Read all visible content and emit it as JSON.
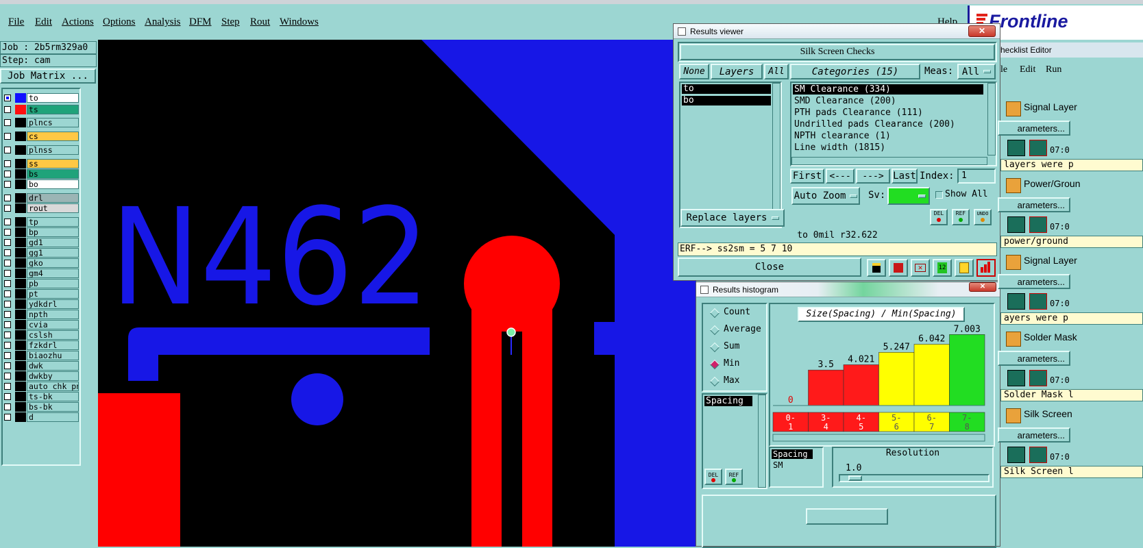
{
  "menubar": {
    "items": [
      "File",
      "Edit",
      "Actions",
      "Options",
      "Analysis",
      "DFM",
      "Step",
      "Rout",
      "Windows"
    ],
    "help": "Help",
    "brand": "Frontline"
  },
  "left": {
    "job": "Job : 2b5rm329a0",
    "step": "Step: cam",
    "job_matrix": "Job Matrix ...",
    "layers": [
      {
        "name": "to",
        "color": "#ffffff",
        "swatch": "#1010ff",
        "checked": true
      },
      {
        "name": "ts",
        "color": "#1fa37a",
        "swatch": "#ff1010",
        "checked": false
      },
      {
        "name": "plncs",
        "color": "#9cd6d2",
        "swatch": "#000000",
        "checked": false
      },
      {
        "name": "cs",
        "color": "#ffc845",
        "swatch": "#000000",
        "checked": false
      },
      {
        "name": "plnss",
        "color": "#9cd6d2",
        "swatch": "#000000",
        "checked": false
      },
      {
        "name": "ss",
        "color": "#ffc845",
        "swatch": "#000000",
        "checked": false
      },
      {
        "name": "bs",
        "color": "#1fa37a",
        "swatch": "#000000",
        "checked": false
      },
      {
        "name": "bo",
        "color": "#ffffff",
        "swatch": "#000000",
        "checked": false
      },
      {
        "name": "drl",
        "color": "#9bb5b5",
        "swatch": "#000000",
        "checked": false
      },
      {
        "name": "rout",
        "color": "#d9d9d9",
        "swatch": "#000000",
        "checked": false
      },
      {
        "name": "tp",
        "color": "#9cd6d2",
        "swatch": "#000000",
        "checked": false
      },
      {
        "name": "bp",
        "color": "#9cd6d2",
        "swatch": "#000000",
        "checked": false
      },
      {
        "name": "gd1",
        "color": "#9cd6d2",
        "swatch": "#000000",
        "checked": false
      },
      {
        "name": "gg1",
        "color": "#9cd6d2",
        "swatch": "#000000",
        "checked": false
      },
      {
        "name": "gko",
        "color": "#9cd6d2",
        "swatch": "#000000",
        "checked": false
      },
      {
        "name": "gm4",
        "color": "#9cd6d2",
        "swatch": "#000000",
        "checked": false
      },
      {
        "name": "pb",
        "color": "#9cd6d2",
        "swatch": "#000000",
        "checked": false
      },
      {
        "name": "pt",
        "color": "#9cd6d2",
        "swatch": "#000000",
        "checked": false
      },
      {
        "name": "ydkdrl",
        "color": "#9cd6d2",
        "swatch": "#000000",
        "checked": false
      },
      {
        "name": "npth",
        "color": "#9cd6d2",
        "swatch": "#000000",
        "checked": false
      },
      {
        "name": "cvia",
        "color": "#9cd6d2",
        "swatch": "#000000",
        "checked": false
      },
      {
        "name": "cslsh",
        "color": "#9cd6d2",
        "swatch": "#000000",
        "checked": false
      },
      {
        "name": "fzkdrl",
        "color": "#9cd6d2",
        "swatch": "#000000",
        "checked": false
      },
      {
        "name": "biaozhu",
        "color": "#9cd6d2",
        "swatch": "#000000",
        "checked": false
      },
      {
        "name": "dwk",
        "color": "#9cd6d2",
        "swatch": "#000000",
        "checked": false
      },
      {
        "name": "dwkby",
        "color": "#9cd6d2",
        "swatch": "#000000",
        "checked": false
      },
      {
        "name": "auto_chk_pn",
        "color": "#9cd6d2",
        "swatch": "#000000",
        "checked": false
      },
      {
        "name": "ts-bk",
        "color": "#9cd6d2",
        "swatch": "#000000",
        "checked": false
      },
      {
        "name": "bs-bk",
        "color": "#9cd6d2",
        "swatch": "#000000",
        "checked": false
      },
      {
        "name": "d",
        "color": "#9cd6d2",
        "swatch": "#000000",
        "checked": false
      }
    ]
  },
  "canvas": {
    "silk_text": "N462",
    "colors": {
      "silk": "#1717e6",
      "pad": "#ff0000",
      "bg": "#000000"
    }
  },
  "results_viewer": {
    "title": "Results viewer",
    "close_x": "✕",
    "header": "Silk Screen Checks",
    "none_label": "None",
    "layers_label": "Layers",
    "all_label": "All",
    "categories_label": "Categories (15)",
    "meas_label": "Meas:",
    "meas_value": "All",
    "layer_list": [
      "to",
      "bo"
    ],
    "categories": [
      "SM Clearance (334)",
      "SMD Clearance (200)",
      "PTH pads Clearance (111)",
      "Undrilled pads Clearance (200)",
      "NPTH clearance (1)",
      "Line width (1815)"
    ],
    "first": "First",
    "prev": "<---",
    "next": "--->",
    "last": "Last",
    "index_label": "Index:",
    "index_value": "1",
    "auto_zoom": "Auto Zoom",
    "sv_label": "Sv:",
    "show_all": "Show All",
    "replace_layers": "Replace layers",
    "del": "DEL",
    "ref": "REF",
    "undo": "UNDO",
    "measure": "to 0mil  r32.622",
    "erf": "ERF--> ss2sm = 5 7 10",
    "close": "Close"
  },
  "histogram": {
    "title": "Results histogram",
    "close_x": "✕",
    "radios": [
      "Count",
      "Average",
      "Sum",
      "Min",
      "Max"
    ],
    "selected": "Min",
    "param_list": [
      "Spacing"
    ],
    "chart_title": "Size(Spacing) / Min(Spacing)",
    "bins": [
      {
        "range_top": "0-",
        "range_bottom": "1",
        "value": 0,
        "label": "0",
        "color": "#ff1a1a"
      },
      {
        "range_top": "3-",
        "range_bottom": "4",
        "value": 3.5,
        "label": "3.5",
        "color": "#ff1a1a"
      },
      {
        "range_top": "4-",
        "range_bottom": "5",
        "value": 4.021,
        "label": "4.021",
        "color": "#ff1a1a"
      },
      {
        "range_top": "5-",
        "range_bottom": "6",
        "value": 5.247,
        "label": "5.247",
        "color": "#ffff00"
      },
      {
        "range_top": "6-",
        "range_bottom": "7",
        "value": 6.042,
        "label": "6.042",
        "color": "#ffff00"
      },
      {
        "range_top": "7-",
        "range_bottom": "8",
        "value": 7.003,
        "label": "7.003",
        "color": "#22dd22"
      }
    ],
    "ymax": 7.003,
    "sub_list": [
      "Spacing",
      "SM"
    ],
    "resolution_label": "Resolution",
    "resolution_value": "1.0",
    "del": "DEL",
    "ref": "REF"
  },
  "checklist": {
    "title": "hecklist Editor",
    "menu": [
      "le",
      "Edit",
      "Run"
    ],
    "groups": [
      {
        "name": "Signal Layer",
        "params": "arameters...",
        "time": "07:0",
        "msg": "layers were p"
      },
      {
        "name": "Power/Groun",
        "params": "arameters...",
        "time": "07:0",
        "msg": "power/ground"
      },
      {
        "name": "Signal Layer",
        "params": "arameters...",
        "time": "07:0",
        "msg": "ayers were p"
      },
      {
        "name": "Solder Mask",
        "params": "arameters...",
        "time": "07:0",
        "msg": "Solder Mask l"
      },
      {
        "name": "Silk Screen",
        "params": "arameters...",
        "time": "07:0",
        "msg": "Silk Screen l"
      }
    ]
  }
}
